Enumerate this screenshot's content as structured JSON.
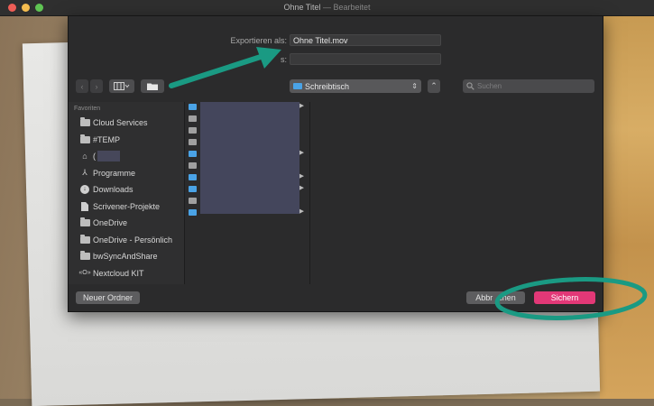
{
  "window": {
    "title": "Ohne Titel",
    "separator": "—",
    "subtitle": "Bearbeitet"
  },
  "dialog": {
    "export_label": "Exportieren als:",
    "export_value": "Ohne Titel.mov",
    "tags_label_partial": "s:",
    "location": "Schreibtisch",
    "search_placeholder": "Suchen"
  },
  "sidebar": {
    "heading": "Favoriten",
    "items": [
      {
        "label": "Cloud Services",
        "icon": "folder-icon"
      },
      {
        "label": "#TEMP",
        "icon": "folder-icon"
      },
      {
        "label": "(",
        "icon": "home-icon"
      },
      {
        "label": "Programme",
        "icon": "applications-icon"
      },
      {
        "label": "Downloads",
        "icon": "download-icon"
      },
      {
        "label": "Scrivener-Projekte",
        "icon": "document-icon"
      },
      {
        "label": "OneDrive",
        "icon": "folder-icon"
      },
      {
        "label": "OneDrive - Persönlich",
        "icon": "folder-icon"
      },
      {
        "label": "bwSyncAndShare",
        "icon": "folder-icon"
      },
      {
        "label": "Nextcloud KIT",
        "icon": "network-icon"
      }
    ]
  },
  "footer": {
    "new_folder": "Neuer Ordner",
    "cancel_a": "Abbr",
    "cancel_b": "chen",
    "save": "Sichern"
  },
  "colors": {
    "annotation": "#1a9a83",
    "save_accent": "#e23877",
    "folder_blue": "#4aa3e6"
  }
}
